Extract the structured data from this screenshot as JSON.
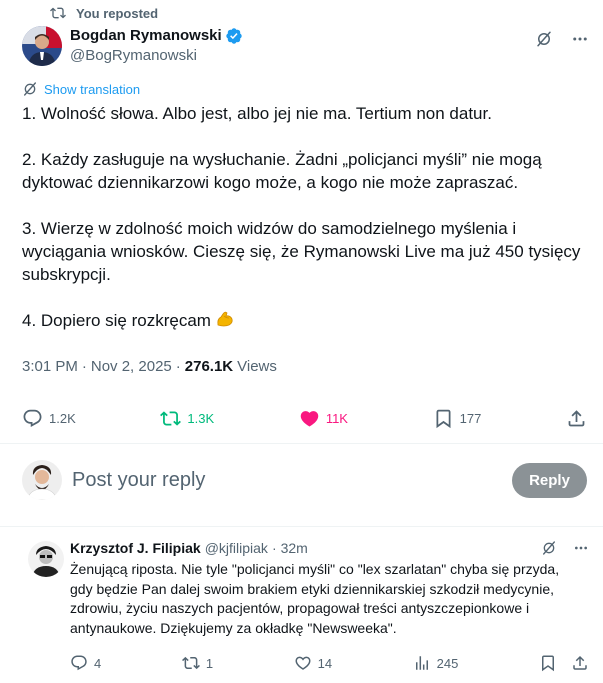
{
  "repost": {
    "label": "You reposted"
  },
  "tweet": {
    "author_name": "Bogdan Rymanowski",
    "author_handle": "@BogRymanowski",
    "show_translation": "Show translation",
    "paragraphs": [
      "1. Wolność słowa. Albo jest, albo jej nie ma. Tertium non datur.",
      "2. Każdy zasługuje na wysłuchanie. Żadni „policjanci myśli” nie mogą dyktować dziennikarzowi kogo może, a kogo nie może zapraszać.",
      "3. Wierzę w zdolność moich widzów do samodzielnego myślenia i wyciągania wniosków. Cieszę się, że Rymanowski Live ma już 450 tysięcy subskrypcji.",
      "4. Dopiero się rozkręcam"
    ],
    "time": "3:01 PM",
    "date": "Nov 2, 2025",
    "views_count": "276.1K",
    "views_label": "Views",
    "replies": "1.2K",
    "reposts": "1.3K",
    "likes": "11K",
    "bookmarks": "177"
  },
  "reply_box": {
    "placeholder": "Post your reply",
    "button": "Reply"
  },
  "comment": {
    "author_name": "Krzysztof J. Filipiak",
    "author_handle": "@kjfilipiak",
    "time": "32m",
    "text": "Żenującą riposta. Nie tyle \"policjanci myśli\" co \"lex szarlatan\" chyba się przyda, gdy będzie Pan dalej swoim brakiem etyki dziennikarskiej szkodził medycynie, zdrowiu, życiu naszych pacjentów, propagował treści antyszczepionkowe i antynaukowe. Dziękujemy za okładkę \"Newsweeka\".",
    "replies": "4",
    "reposts": "1",
    "likes": "14",
    "views": "245"
  },
  "colors": {
    "accent": "#1d9bf0",
    "repost_green": "#00ba7c",
    "like_pink": "#f91880",
    "muted": "#536471"
  }
}
